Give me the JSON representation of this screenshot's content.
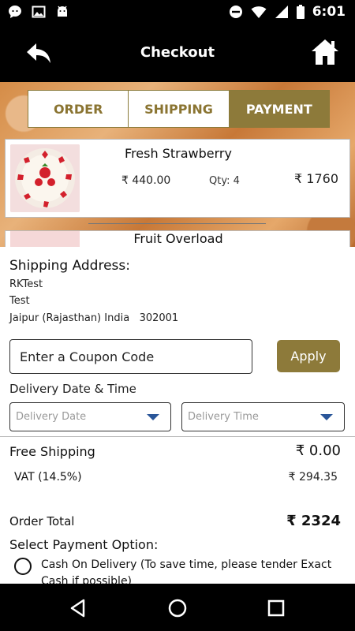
{
  "status_bar": {
    "time": "6:01",
    "left_icons": [
      "chat-bubble-icon",
      "image-icon",
      "android-icon"
    ],
    "right_icons": [
      "do-not-disturb-icon",
      "wifi-icon",
      "signal-icon",
      "battery-icon"
    ]
  },
  "app_bar": {
    "title": "Checkout",
    "back_icon": "back-arrow-icon",
    "home_icon": "home-icon"
  },
  "tabs": [
    {
      "label": "ORDER",
      "active": false
    },
    {
      "label": "SHIPPING",
      "active": false
    },
    {
      "label": "PAYMENT",
      "active": true
    }
  ],
  "cart": [
    {
      "name": "Fresh Strawberry",
      "price": "₹ 440.00",
      "qty": "Qty: 4",
      "total": "₹ 1760"
    },
    {
      "name": "Fruit Overload"
    }
  ],
  "shipping": {
    "heading": "Shipping Address:",
    "line1": "RKTest",
    "line2": "Test",
    "line3": "Jaipur (Rajasthan) India   302001"
  },
  "coupon": {
    "placeholder": "Enter a Coupon Code",
    "apply_label": "Apply"
  },
  "delivery": {
    "label": "Delivery Date & Time",
    "date_placeholder": "Delivery Date",
    "time_placeholder": "Delivery Time"
  },
  "summary": {
    "shipping_label": "Free Shipping",
    "shipping_value": "₹ 0.00",
    "vat_label": "VAT (14.5%)",
    "vat_value": "₹ 294.35",
    "total_label": "Order Total",
    "total_value": "₹ 2324"
  },
  "payment": {
    "heading": "Select Payment Option:",
    "options": [
      {
        "label": "Cash On Delivery (To save time, please tender Exact Cash if possible)",
        "selected": false
      }
    ]
  },
  "colors": {
    "accent": "#8d7a3a",
    "bar": "#000000",
    "caret": "#2a5699"
  }
}
